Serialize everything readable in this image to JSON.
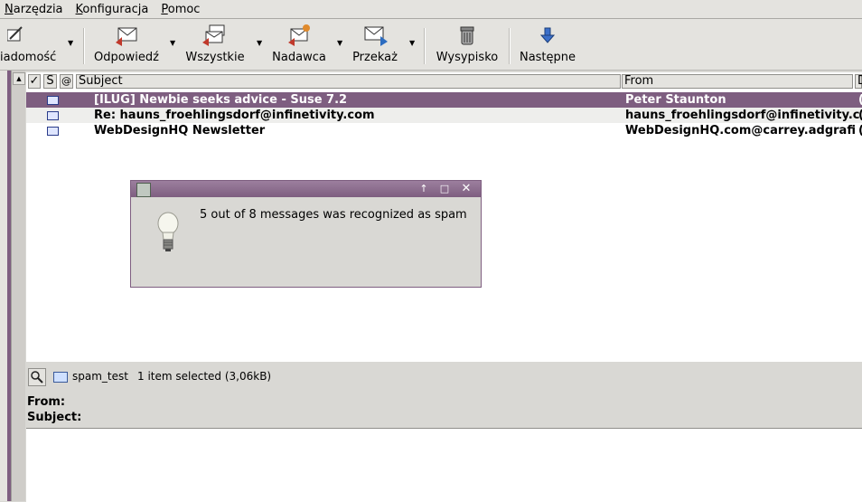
{
  "menu": [
    "Narzędzia",
    "Konfiguracja",
    "Pomoc"
  ],
  "toolbar": {
    "compose": "iadomość",
    "reply": "Odpowiedź",
    "reply_all": "Wszystkie",
    "reply_sender": "Nadawca",
    "forward": "Przekaż",
    "trash": "Wysypisko",
    "next": "Następne"
  },
  "list": {
    "columns": {
      "check": "✓",
      "status": "S",
      "attach": "@",
      "subject": "Subject",
      "from": "From",
      "date": "D"
    },
    "rows": [
      {
        "subject": "[ILUG] Newbie seeks advice - Suse 7.2",
        "from": "Peter Staunton",
        "tail": "("
      },
      {
        "subject": "Re: hauns_froehlingsdorf@infinetivity.com",
        "from": "hauns_froehlingsdorf@infinetivity.c",
        "tail": "("
      },
      {
        "subject": "WebDesignHQ Newsletter",
        "from": "WebDesignHQ.com@carrey.adgrafi",
        "tail": "("
      }
    ]
  },
  "status": {
    "folder": "spam_test",
    "selection": "1 item selected (3,06kB)"
  },
  "headers": {
    "from_label": "From:",
    "subject_label": "Subject:"
  },
  "dialog": {
    "message": "5 out of 8 messages was recognized as spam"
  },
  "colors": {
    "accent": "#7e5e80",
    "selected_row": "#7e5e80"
  }
}
